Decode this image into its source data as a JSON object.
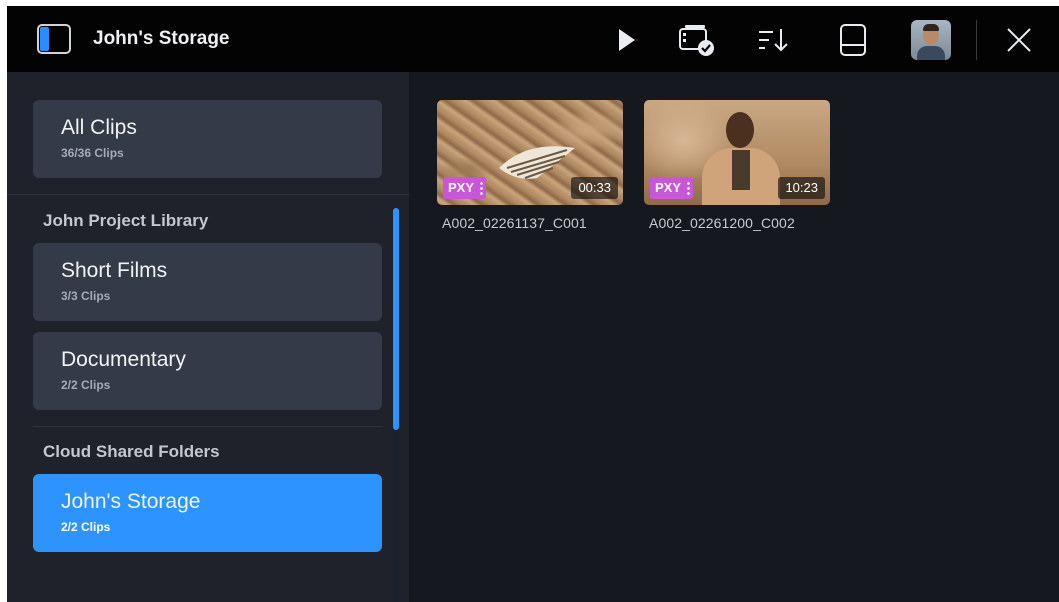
{
  "header": {
    "title": "John's Storage",
    "icons": [
      "sidebar-toggle-icon",
      "play-icon",
      "clip-select-icon",
      "sort-icon",
      "drive-icon",
      "user-avatar",
      "close-icon"
    ]
  },
  "sidebar": {
    "all_clips": {
      "label": "All Clips",
      "count": "36/36 Clips"
    },
    "project_library": {
      "heading": "John Project Library",
      "items": [
        {
          "label": "Short Films",
          "count": "3/3 Clips"
        },
        {
          "label": "Documentary",
          "count": "2/2 Clips"
        }
      ]
    },
    "cloud_shared": {
      "heading": "Cloud Shared Folders",
      "items": [
        {
          "label": "John's Storage",
          "count": "2/2 Clips",
          "active": true
        }
      ]
    }
  },
  "clips": [
    {
      "name": "A002_02261137_C001",
      "badge": "PXY",
      "duration": "00:33"
    },
    {
      "name": "A002_02261200_C002",
      "badge": "PXY",
      "duration": "10:23"
    }
  ],
  "colors": {
    "accent": "#2d94ff",
    "proxy_badge": "#c955d8",
    "background": "#15181e",
    "topbar": "#030304",
    "card": "#343a48"
  }
}
